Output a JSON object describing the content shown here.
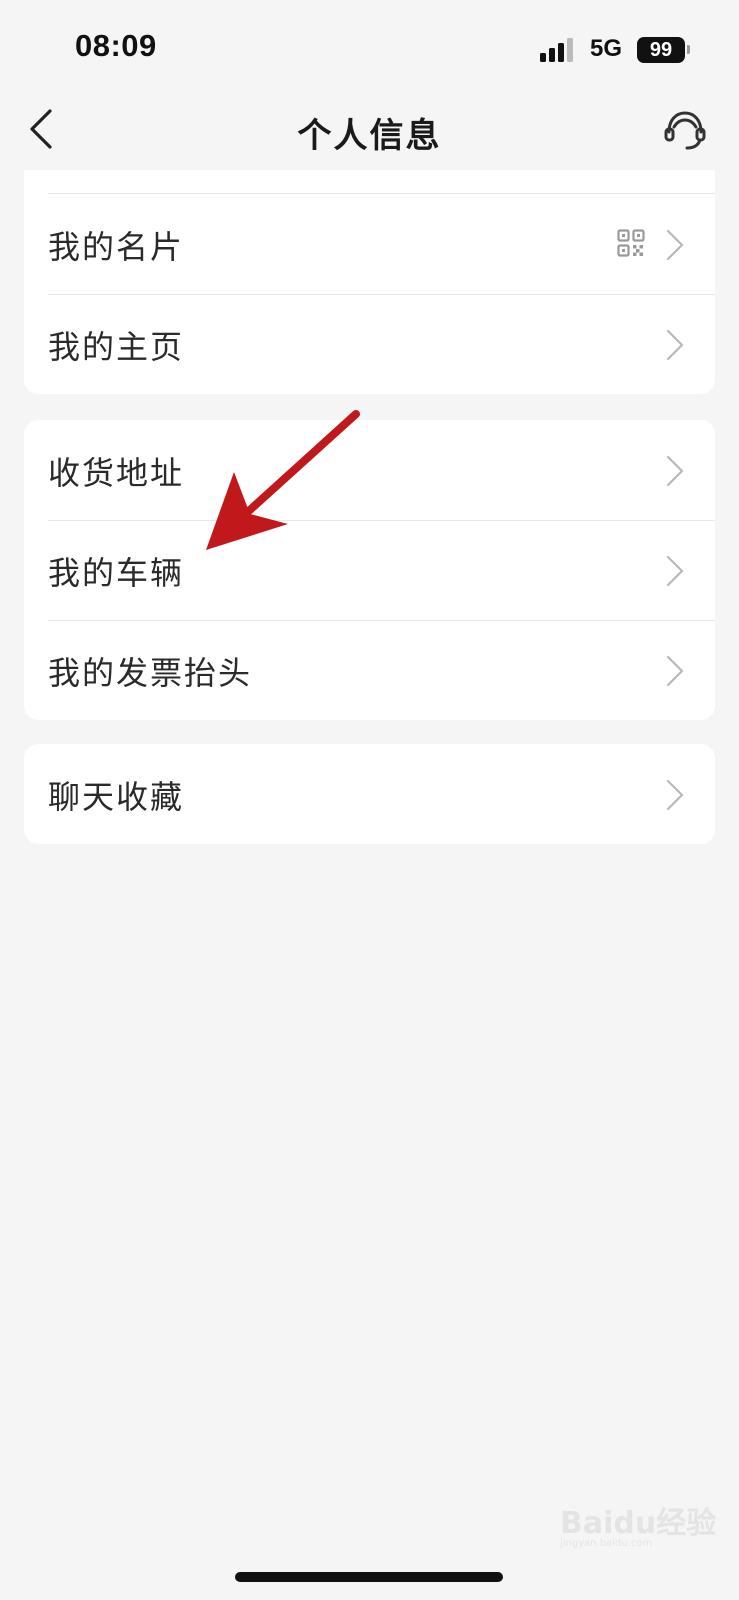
{
  "status_bar": {
    "time": "08:09",
    "network": "5G",
    "battery": "99"
  },
  "nav": {
    "title": "个人信息",
    "back_icon": "chevron-left-icon",
    "service_icon": "headset-icon"
  },
  "groups": [
    {
      "items": [
        {
          "label": "我的名片",
          "extra_icon": "qr-code-icon"
        },
        {
          "label": "我的主页"
        }
      ]
    },
    {
      "items": [
        {
          "label": "收货地址"
        },
        {
          "label": "我的车辆"
        },
        {
          "label": "我的发票抬头"
        }
      ]
    },
    {
      "items": [
        {
          "label": "聊天收藏"
        }
      ]
    }
  ],
  "annotation": {
    "arrow_color": "#c0181b"
  },
  "watermark": {
    "text": "Baidu经验",
    "sub": "jingyan.baidu.com"
  }
}
